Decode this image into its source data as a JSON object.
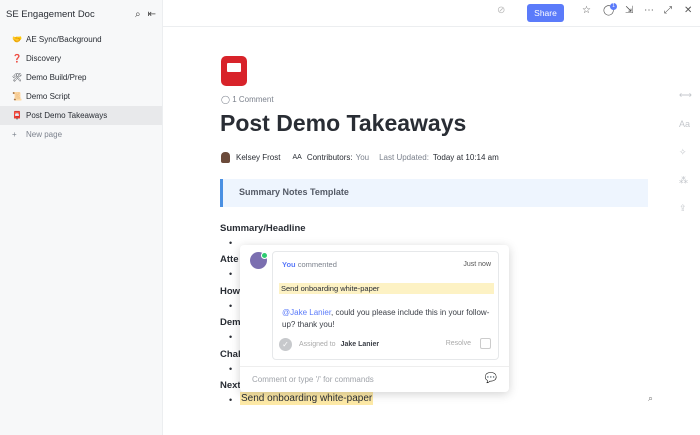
{
  "sidebar": {
    "title": "SE Engagement Doc",
    "items": [
      {
        "emoji": "🤝",
        "label": "AE Sync/Background"
      },
      {
        "emoji": "❓",
        "label": "Discovery"
      },
      {
        "emoji": "🛠",
        "label": "Demo Build/Prep"
      },
      {
        "emoji": "📜",
        "label": "Demo Script"
      },
      {
        "emoji": "📮",
        "label": "Post Demo Takeaways"
      }
    ],
    "new_page": "New page"
  },
  "topbar": {
    "share": "Share",
    "notification_count": "1"
  },
  "doc": {
    "comments": "1 Comment",
    "title": "Post Demo Takeaways",
    "author": "Kelsey Frost",
    "contributors_label": "Contributors:",
    "contributors": "You",
    "updated_label": "Last Updated:",
    "updated": "Today at 10:14 am",
    "callout": "Summary Notes Template",
    "sections": [
      "Summary/Headline",
      "Atte",
      "How",
      "Dem",
      "Chal",
      "Next"
    ],
    "highlight": "Send onboarding white-paper"
  },
  "comment": {
    "author": "You",
    "action": "commented",
    "time": "Just now",
    "quote": "Send onboarding white-paper",
    "mention": "@Jake Lanier",
    "text": ", could you please include this in your follow-up? thank you!",
    "assigned_label": "Assigned to",
    "assignee": "Jake Lanier",
    "resolve": "Resolve",
    "placeholder": "Comment or type '/' for commands"
  },
  "colors": {
    "accent": "#5b7bfa",
    "highlight": "#fde9a6",
    "callout_border": "#4a90e2"
  }
}
